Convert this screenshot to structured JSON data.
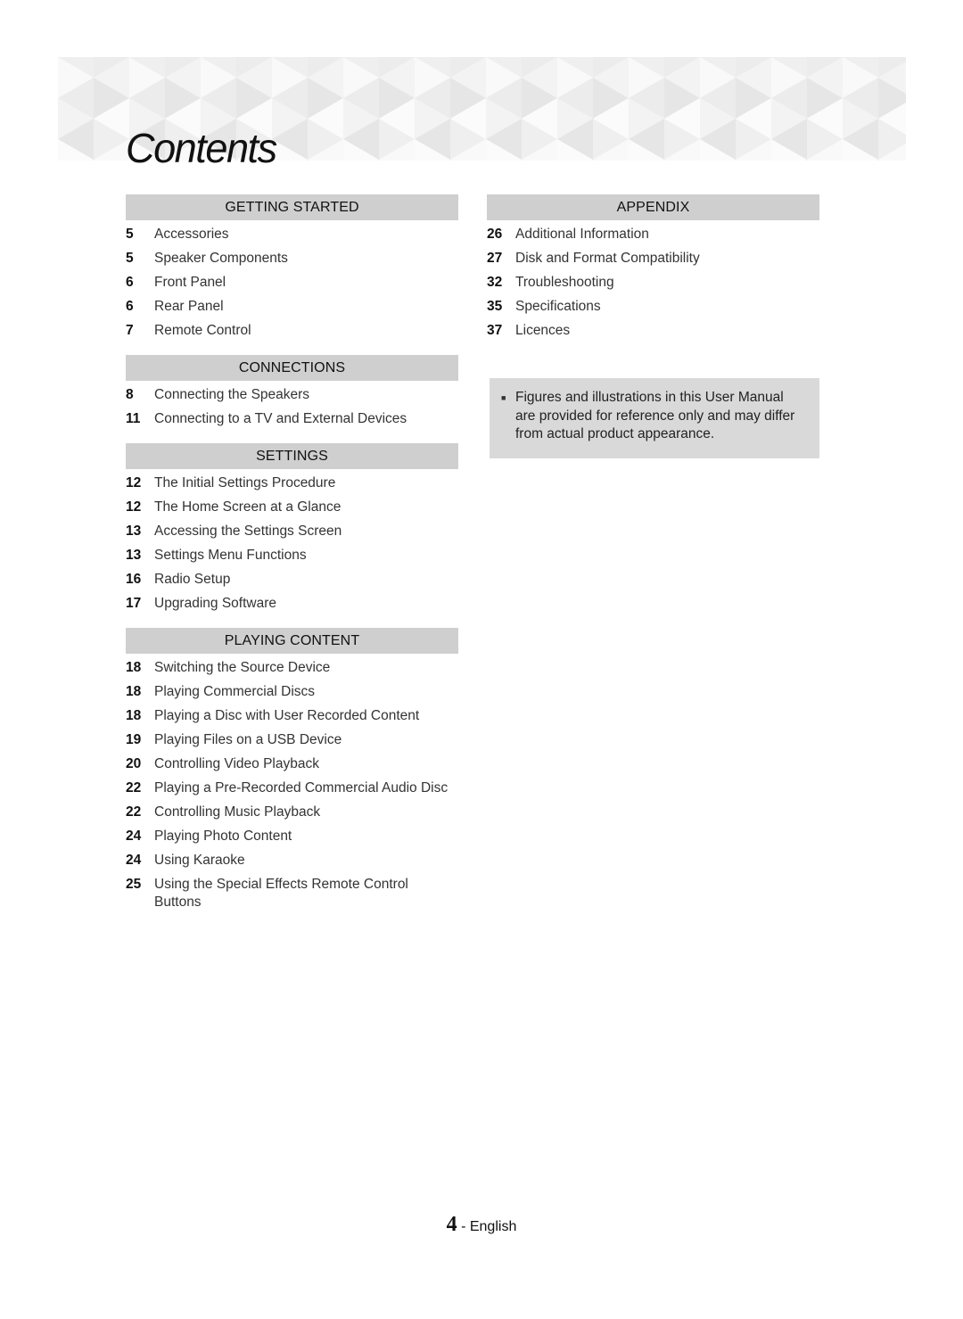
{
  "header": {
    "title": "Contents"
  },
  "sections_left": [
    {
      "heading": "GETTING STARTED",
      "items": [
        {
          "page": "5",
          "title": "Accessories"
        },
        {
          "page": "5",
          "title": "Speaker Components"
        },
        {
          "page": "6",
          "title": "Front Panel"
        },
        {
          "page": "6",
          "title": "Rear Panel"
        },
        {
          "page": "7",
          "title": "Remote Control"
        }
      ]
    },
    {
      "heading": "CONNECTIONS",
      "items": [
        {
          "page": "8",
          "title": "Connecting the Speakers"
        },
        {
          "page": "11",
          "title": "Connecting to a TV and External Devices"
        }
      ]
    },
    {
      "heading": "SETTINGS",
      "items": [
        {
          "page": "12",
          "title": "The Initial Settings Procedure"
        },
        {
          "page": "12",
          "title": "The Home Screen at a Glance"
        },
        {
          "page": "13",
          "title": "Accessing the Settings Screen"
        },
        {
          "page": "13",
          "title": "Settings Menu Functions"
        },
        {
          "page": "16",
          "title": "Radio Setup"
        },
        {
          "page": "17",
          "title": "Upgrading Software"
        }
      ]
    },
    {
      "heading": "PLAYING CONTENT",
      "items": [
        {
          "page": "18",
          "title": "Switching the Source Device"
        },
        {
          "page": "18",
          "title": "Playing Commercial Discs"
        },
        {
          "page": "18",
          "title": "Playing a Disc with User Recorded Content"
        },
        {
          "page": "19",
          "title": "Playing Files on a USB Device"
        },
        {
          "page": "20",
          "title": "Controlling Video Playback"
        },
        {
          "page": "22",
          "title": "Playing a Pre-Recorded Commercial Audio Disc"
        },
        {
          "page": "22",
          "title": "Controlling Music Playback"
        },
        {
          "page": "24",
          "title": "Playing Photo Content"
        },
        {
          "page": "24",
          "title": "Using Karaoke"
        },
        {
          "page": "25",
          "title": "Using the Special Effects Remote Control Buttons"
        }
      ]
    }
  ],
  "sections_right": [
    {
      "heading": "APPENDIX",
      "items": [
        {
          "page": "26",
          "title": "Additional Information"
        },
        {
          "page": "27",
          "title": "Disk and Format Compatibility"
        },
        {
          "page": "32",
          "title": "Troubleshooting"
        },
        {
          "page": "35",
          "title": "Specifications"
        },
        {
          "page": "37",
          "title": "Licences"
        }
      ]
    }
  ],
  "note": {
    "bullet": "■",
    "text": "Figures and illustrations in this User Manual are provided for reference only and may differ from actual product appearance."
  },
  "footer": {
    "page_number": "4",
    "separator": " - ",
    "language": "English"
  },
  "colors": {
    "section_header_bg": "#cfcfcf",
    "note_bg": "#d9d9d9"
  }
}
